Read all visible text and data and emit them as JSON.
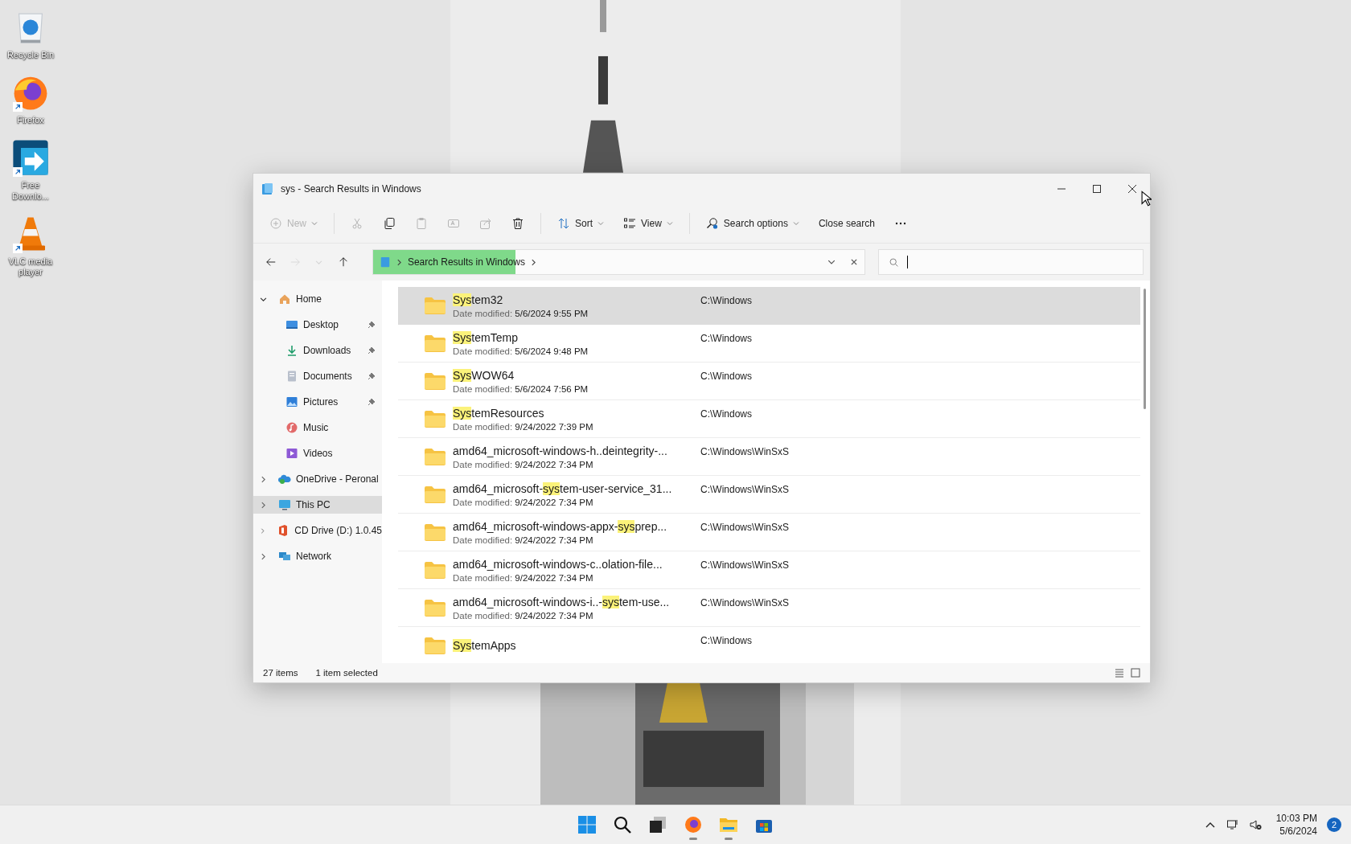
{
  "desktop_icons": [
    {
      "label": "Recycle Bin",
      "kind": "recycle",
      "shortcut": false
    },
    {
      "label": "Firefox",
      "kind": "firefox",
      "shortcut": true
    },
    {
      "label": "Free Downlo...",
      "kind": "downloader",
      "shortcut": true
    },
    {
      "label": "VLC media player",
      "kind": "vlc",
      "shortcut": true
    }
  ],
  "window": {
    "title": "sys - Search Results in Windows",
    "toolbar": [
      {
        "kind": "new",
        "label": "New",
        "disabled": true
      },
      {
        "kind": "cut",
        "disabled": true
      },
      {
        "kind": "copy",
        "disabled": false
      },
      {
        "kind": "paste",
        "disabled": true
      },
      {
        "kind": "rename",
        "disabled": true
      },
      {
        "kind": "share",
        "disabled": true
      },
      {
        "kind": "delete",
        "disabled": false
      },
      {
        "kind": "sort",
        "label": "Sort",
        "disabled": false
      },
      {
        "kind": "view",
        "label": "View",
        "disabled": false
      },
      {
        "kind": "search-options",
        "label": "Search options",
        "disabled": false
      },
      {
        "kind": "close-search",
        "label": "Close search",
        "disabled": false
      },
      {
        "kind": "more",
        "disabled": false
      }
    ],
    "nav_buttons": [
      {
        "kind": "back",
        "disabled": false
      },
      {
        "kind": "forward",
        "disabled": true
      },
      {
        "kind": "recent",
        "disabled": true
      },
      {
        "kind": "up",
        "disabled": false
      }
    ],
    "address": {
      "crumbs": [
        "Search Results in Windows"
      ],
      "level": 0.29
    },
    "sidebar": [
      {
        "label": "Home",
        "kind": "home",
        "expanded": true,
        "selected": false,
        "children": [
          {
            "label": "Desktop",
            "kind": "desktop",
            "pinned": true,
            "selected": false
          },
          {
            "label": "Downloads",
            "kind": "downloads",
            "pinned": true,
            "selected": false
          },
          {
            "label": "Documents",
            "kind": "documents",
            "pinned": true,
            "selected": false
          },
          {
            "label": "Pictures",
            "kind": "pictures",
            "pinned": true,
            "selected": false
          },
          {
            "label": "Music",
            "kind": "music",
            "pinned": false,
            "selected": false
          },
          {
            "label": "Videos",
            "kind": "videos",
            "pinned": false,
            "selected": false
          }
        ]
      },
      {
        "label": "OneDrive - Peronal",
        "kind": "cloud",
        "expanded": false,
        "selected": false
      },
      {
        "label": "This PC",
        "kind": "pc",
        "expanded": false,
        "selected": true
      },
      {
        "label": "CD Drive (D:) 1.0.45",
        "kind": "cd",
        "expanded": false,
        "selected": false
      },
      {
        "label": "Network",
        "kind": "network",
        "expanded": false,
        "selected": false
      }
    ],
    "rows": [
      {
        "name": [
          {
            "text": "Sys",
            "match": true
          },
          {
            "text": "tem32",
            "match": false
          }
        ],
        "date_label": "Date modified:",
        "date": "5/6/2024 9:55 PM",
        "location": "C:\\Windows",
        "selected": true
      },
      {
        "name": [
          {
            "text": "Sys",
            "match": true
          },
          {
            "text": "temTemp",
            "match": false
          }
        ],
        "date_label": "Date modified:",
        "date": "5/6/2024 9:48 PM",
        "location": "C:\\Windows",
        "selected": false
      },
      {
        "name": [
          {
            "text": "Sys",
            "match": true
          },
          {
            "text": "WOW64",
            "match": false
          }
        ],
        "date_label": "Date modified:",
        "date": "5/6/2024 7:56 PM",
        "location": "C:\\Windows",
        "selected": false
      },
      {
        "name": [
          {
            "text": "Sys",
            "match": true
          },
          {
            "text": "temResources",
            "match": false
          }
        ],
        "date_label": "Date modified:",
        "date": "9/24/2022 7:39 PM",
        "location": "C:\\Windows",
        "selected": false
      },
      {
        "name": [
          {
            "text": "amd64_microsoft-windows-h..deintegrity-...",
            "match": false
          }
        ],
        "date_label": "Date modified:",
        "date": "9/24/2022 7:34 PM",
        "location": "C:\\Windows\\WinSxS",
        "selected": false
      },
      {
        "name": [
          {
            "text": "amd64_microsoft-",
            "match": false
          },
          {
            "text": "sys",
            "match": true
          },
          {
            "text": "tem-user-service_31...",
            "match": false
          }
        ],
        "date_label": "Date modified:",
        "date": "9/24/2022 7:34 PM",
        "location": "C:\\Windows\\WinSxS",
        "selected": false
      },
      {
        "name": [
          {
            "text": "amd64_microsoft-windows-appx-",
            "match": false
          },
          {
            "text": "sys",
            "match": true
          },
          {
            "text": "prep...",
            "match": false
          }
        ],
        "date_label": "Date modified:",
        "date": "9/24/2022 7:34 PM",
        "location": "C:\\Windows\\WinSxS",
        "selected": false
      },
      {
        "name": [
          {
            "text": "amd64_microsoft-windows-c..olation-file...",
            "match": false
          }
        ],
        "date_label": "Date modified:",
        "date": "9/24/2022 7:34 PM",
        "location": "C:\\Windows\\WinSxS",
        "selected": false
      },
      {
        "name": [
          {
            "text": "amd64_microsoft-windows-i..-",
            "match": false
          },
          {
            "text": "sys",
            "match": true
          },
          {
            "text": "tem-use...",
            "match": false
          }
        ],
        "date_label": "Date modified:",
        "date": "9/24/2022 7:34 PM",
        "location": "C:\\Windows\\WinSxS",
        "selected": false
      },
      {
        "name": [
          {
            "text": "Sys",
            "match": true
          },
          {
            "text": "temApps",
            "match": false
          }
        ],
        "location": "C:\\Windows",
        "selected": false
      }
    ],
    "status_bar": {
      "count": "27 items",
      "selection": "1 item selected"
    }
  },
  "taskbar": {
    "apps": [
      {
        "kind": "start",
        "running": false
      },
      {
        "kind": "search",
        "running": false
      },
      {
        "kind": "taskview",
        "running": false
      },
      {
        "kind": "firefox",
        "running": true
      },
      {
        "kind": "explorer",
        "running": true
      },
      {
        "kind": "store",
        "running": false
      }
    ],
    "time": "10:03 PM",
    "date": "5/6/2024",
    "notifications": "2"
  }
}
